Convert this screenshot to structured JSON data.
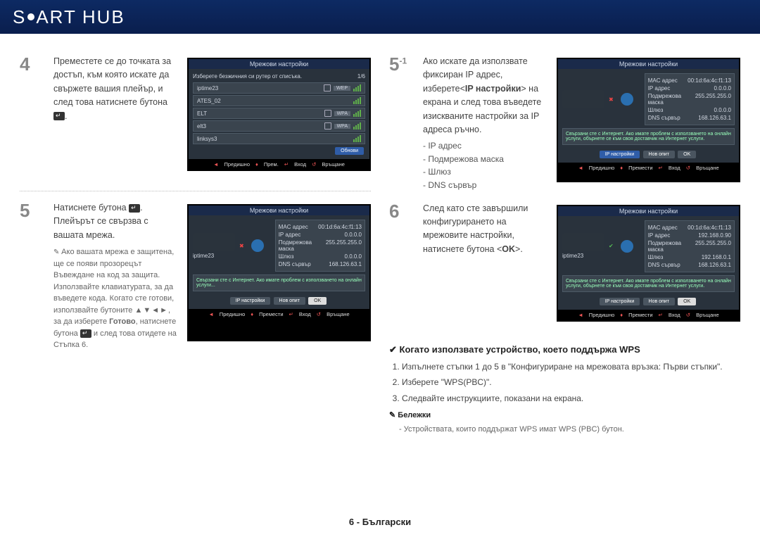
{
  "banner": {
    "pre": "S",
    "mid": "ART",
    "post": "HUB"
  },
  "left": {
    "step4": {
      "num": "4",
      "text": "Преместете се до точката за достъп, към която искате да свържете вашия плейър, и след това натиснете бутона ",
      "icon_hint": "enter"
    },
    "screenshot4": {
      "title": "Мрежови настройки",
      "hint": "Изберете безжичния си рутер от списъка.",
      "page": "1/6",
      "rows": [
        {
          "name": "iptime23",
          "sec": "WEP"
        },
        {
          "name": "ATES_02",
          "sec": ""
        },
        {
          "name": "ELT",
          "sec": "WPA"
        },
        {
          "name": "elt3",
          "sec": "WPA"
        },
        {
          "name": "linksys3",
          "sec": ""
        }
      ],
      "refresh": "Обнови",
      "status": {
        "a": "Предишно",
        "b": "Прем.",
        "c": "Вход",
        "d": "Връщане"
      }
    },
    "step5": {
      "num": "5",
      "text1": "Натиснете бутона ",
      "text2": ". Плейърът се свързва с вашата мрежа.",
      "note": "Ако вашата мрежа е защитена, ще се появи прозорецът Въвеждане на код за защита. Използвайте клавиатурата, за да въведете кода. Когато сте готови, използвайте бутоните",
      "arrows": "▲▼◄►",
      "note2": ", за да изберете",
      "bold": "Готово",
      "note3": ", натиснете бутона",
      "note4": "и след това отидете на Стъпка 6."
    },
    "screenshot5": {
      "title": "Мрежови настройки",
      "name": "iptime23",
      "rows": [
        {
          "k": "MAC адрес",
          "v": "00:1d:6a:4c:f1:13"
        },
        {
          "k": "IP адрес",
          "v": "0.0.0.0"
        },
        {
          "k": "Подмрежова маска",
          "v": "255.255.255.0"
        },
        {
          "k": "Шлюз",
          "v": "0.0.0.0"
        },
        {
          "k": "DNS сървър",
          "v": "168.126.63.1"
        }
      ],
      "msg": "Свързани сте с Интернет. Ако имате проблем с използването на онлайн услуги...",
      "btn_ip": "IP настройки",
      "btn_retry": "Нов опит",
      "btn_ok": "OK",
      "status": {
        "a": "Предишно",
        "b": "Премести",
        "c": "Вход",
        "d": "Връщане"
      }
    }
  },
  "right": {
    "step51": {
      "num": "5",
      "sup": "-1",
      "text1": "Ако искате да използвате фиксиран IP адрес, изберете<",
      "bold1": "IP настройки",
      "text2": "> на екрана и след това въведете изискваните настройки за IP адреса ръчно.",
      "list": [
        "IP адрес",
        "Подмрежова маска",
        "Шлюз",
        "DNS сървър"
      ]
    },
    "screenshot51": {
      "title": "Мрежови настройки",
      "rows": [
        {
          "k": "MAC адрес",
          "v": "00:1d:6a:4c:f1:13"
        },
        {
          "k": "IP адрес",
          "v": "0.0.0.0"
        },
        {
          "k": "Подмрежова маска",
          "v": "255.255.255.0"
        },
        {
          "k": "Шлюз",
          "v": "0.0.0.0"
        },
        {
          "k": "DNS сървър",
          "v": "168.126.63.1"
        }
      ],
      "msg": "Свързани сте с Интернет. Ако имате проблем с използването на онлайн услуги, обърнете се към своя доставчик на Интернет услуги.",
      "btn_ip": "IP настройки",
      "btn_retry": "Нов опит",
      "btn_ok": "OK",
      "status": {
        "a": "Предишно",
        "b": "Премести",
        "c": "Вход",
        "d": "Връщане"
      }
    },
    "step6": {
      "num": "6",
      "text": "След като сте завършили конфигурирането на мрежовите настройки, натиснете бутона <",
      "bold": "OK",
      "text2": ">."
    },
    "screenshot6": {
      "title": "Мрежови настройки",
      "name": "iptime23",
      "rows": [
        {
          "k": "MAC адрес",
          "v": "00:1d:6a:4c:f1:13"
        },
        {
          "k": "IP адрес",
          "v": "192.168.0.90"
        },
        {
          "k": "Подмрежова маска",
          "v": "255.255.255.0"
        },
        {
          "k": "Шлюз",
          "v": "192.168.0.1"
        },
        {
          "k": "DNS сървър",
          "v": "168.126.63.1"
        }
      ],
      "msg": "Свързани сте с Интернет. Ако имате проблем с използването на онлайн услуги, обърнете се към своя доставчик на Интернет услуги.",
      "btn_ip": "IP настройки",
      "btn_retry": "Нов опит",
      "btn_ok": "OK",
      "status": {
        "a": "Предишно",
        "b": "Премести",
        "c": "Вход",
        "d": "Връщане"
      }
    },
    "wps": {
      "title": "✔ Когато използвате устройство, което поддържа WPS",
      "items": [
        "Изпълнете стъпки 1 до 5 в \"Конфигуриране на мрежовата връзка: Първи стъпки\".",
        "Изберете \"WPS(PBC)\".",
        "Следвайте инструкциите, показани на екрана."
      ],
      "note_h": "Бележки",
      "note": "Устройствата, които поддържат WPS имат WPS (PBC) бутон."
    }
  },
  "footer": "6 - Български"
}
